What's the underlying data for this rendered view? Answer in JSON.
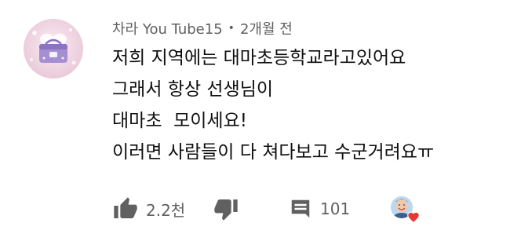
{
  "comment": {
    "author": "차라 You Tube15",
    "separator": "•",
    "time": "2개월 전",
    "lines": [
      "저희 지역에는 대마초등학교라고있어요",
      "그래서 항상 선생님이",
      "대마초  모이세요!",
      "이러면 사람들이 다 쳐다보고 수군거려요ㅠ"
    ]
  },
  "actions": {
    "like_count": "2.2천",
    "reply_count": "101"
  },
  "icons": {
    "like": "thumbs-up-icon",
    "dislike": "thumbs-down-icon",
    "reply": "comment-icon",
    "creator_heart": "heart-icon"
  },
  "colors": {
    "meta_text": "#606060",
    "body_text": "#0f0f0f",
    "icon": "#606060",
    "heart": "#e53935",
    "avatar_bg": "#f3dbe6",
    "avatar_accent": "#9a82c9"
  }
}
